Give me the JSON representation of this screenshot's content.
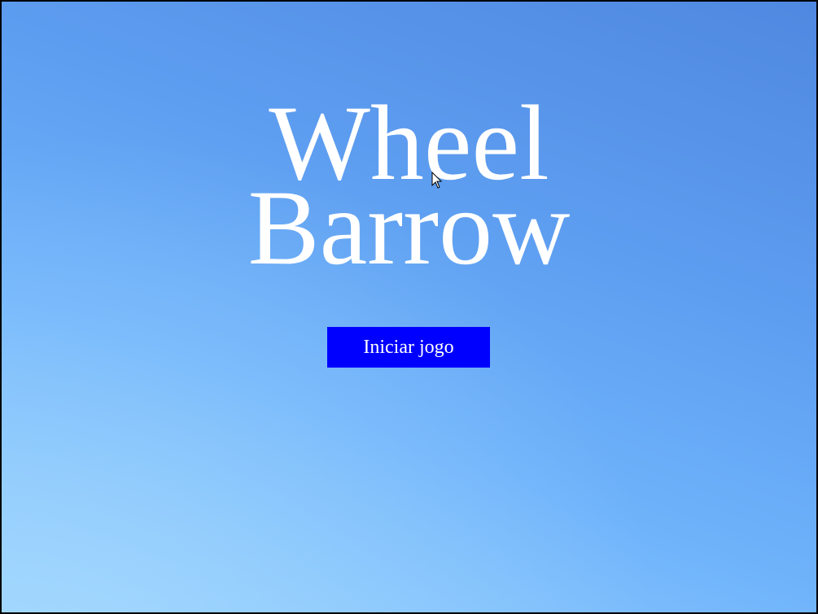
{
  "game": {
    "title_line_1": "Wheel",
    "title_line_2": "Barrow",
    "start_button_label": "Iniciar jogo"
  },
  "colors": {
    "sky_top": "#4f88e0",
    "sky_bottom": "#9ad3fd",
    "title_text": "#ffffff",
    "button_background": "#0000ff",
    "button_text": "#ffffff"
  },
  "icons": {
    "cursor": "mouse-pointer-icon"
  }
}
